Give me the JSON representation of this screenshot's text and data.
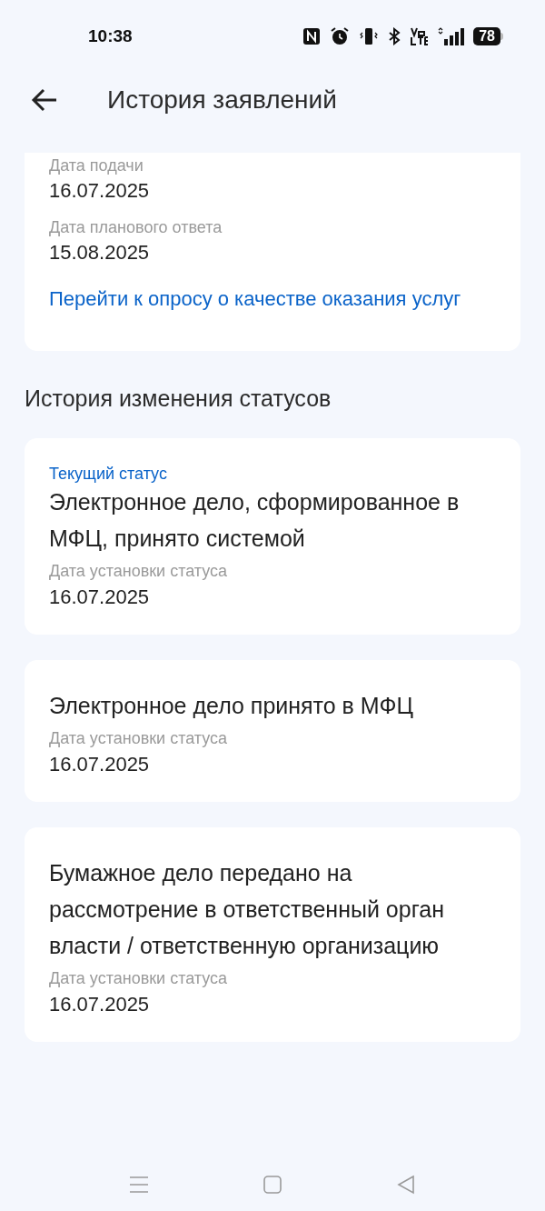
{
  "status_bar": {
    "time": "10:38",
    "battery": "78"
  },
  "header": {
    "title": "История заявлений"
  },
  "details": {
    "fields": [
      {
        "label": "Дата подачи",
        "value": "16.07.2025"
      },
      {
        "label": "Дата планового ответа",
        "value": "15.08.2025"
      }
    ],
    "survey_link": "Перейти к опросу о качестве оказания услуг"
  },
  "section_title": "История изменения статусов",
  "statuses": [
    {
      "current_label": "Текущий статус",
      "title": "Электронное дело, сформированное в МФЦ, принято системой",
      "date_label": "Дата установки статуса",
      "date": "16.07.2025"
    },
    {
      "title": "Электронное дело принято в МФЦ",
      "date_label": "Дата установки статуса",
      "date": "16.07.2025"
    },
    {
      "title": "Бумажное дело передано на рассмотрение в ответственный орган власти / ответственную организацию",
      "date_label": "Дата установки статуса",
      "date": "16.07.2025"
    }
  ]
}
